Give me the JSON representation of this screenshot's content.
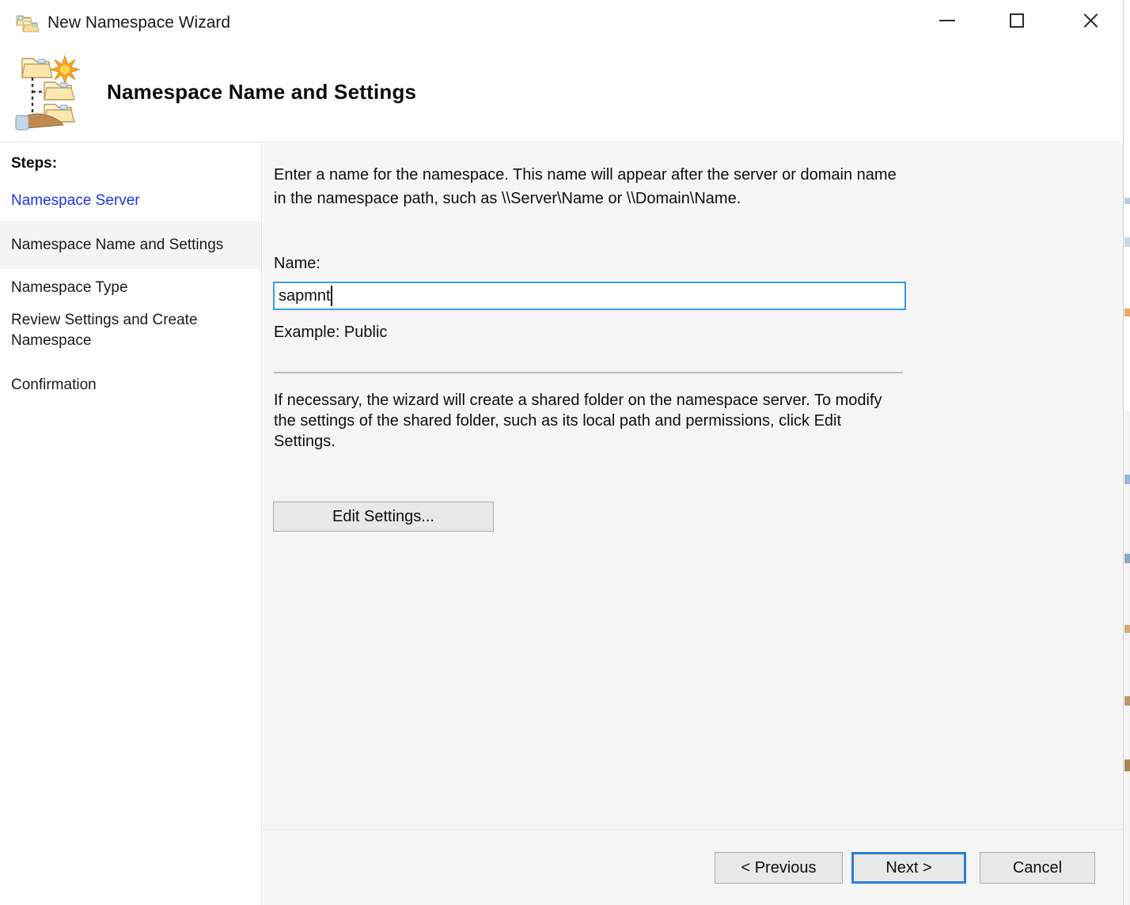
{
  "window": {
    "title": "New Namespace Wizard",
    "title_icon": "namespace-folders-icon",
    "caption": {
      "minimize": "minimize-icon",
      "maximize": "maximize-icon",
      "close": "close-icon"
    }
  },
  "banner": {
    "icon": "namespace-tree-hand-icon",
    "title": "Namespace Name and Settings"
  },
  "sidebar": {
    "heading": "Steps:",
    "items": [
      {
        "label": "Namespace Server",
        "state": "completed-link"
      },
      {
        "label": "Namespace Name and Settings",
        "state": "current"
      },
      {
        "label": "Namespace Type",
        "state": "pending"
      },
      {
        "label": "Review Settings and Create Namespace",
        "state": "pending"
      },
      {
        "label": "Confirmation",
        "state": "pending"
      }
    ]
  },
  "main": {
    "intro_text": "Enter a name for the namespace. This name will appear after the server or domain name in the namespace path, such as \\\\Server\\Name or \\\\Domain\\Name.",
    "name_label": "Name:",
    "name_value": "sapmnt",
    "name_placeholder": "",
    "example_text": "Example: Public",
    "shared_folder_text": "If necessary, the wizard will create a shared folder on the namespace server. To modify the settings of the shared folder, such as its local path and permissions, click Edit Settings.",
    "edit_settings_label": "Edit Settings..."
  },
  "footer": {
    "previous_label": "< Previous",
    "next_label": "Next >",
    "cancel_label": "Cancel"
  },
  "colors": {
    "link_blue": "#1935ea",
    "focus_blue": "#3b9de0",
    "default_button_blue": "#2a7fd4",
    "content_bg": "#f5f5f5",
    "sidebar_band": "#f4f4f4"
  }
}
